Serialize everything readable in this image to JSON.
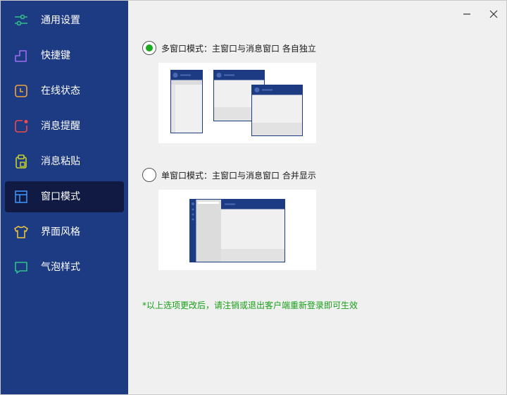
{
  "window": {
    "minimize_icon": "minimize-icon",
    "close_icon": "close-icon"
  },
  "sidebar": {
    "items": [
      {
        "label": "通用设置",
        "icon": "sliders-icon",
        "color": "#2ec08a",
        "active": false
      },
      {
        "label": "快捷键",
        "icon": "step-icon",
        "color": "#9b6cf0",
        "active": false
      },
      {
        "label": "在线状态",
        "icon": "clock-icon",
        "color": "#f2a23a",
        "active": false
      },
      {
        "label": "消息提醒",
        "icon": "notification-icon",
        "color": "#f04a4a",
        "active": false
      },
      {
        "label": "消息粘贴",
        "icon": "clipboard-icon",
        "color": "#c7d12e",
        "active": false
      },
      {
        "label": "窗口模式",
        "icon": "layout-icon",
        "color": "#3d8ff5",
        "active": true
      },
      {
        "label": "界面风格",
        "icon": "shirt-icon",
        "color": "#f2c93a",
        "active": false
      },
      {
        "label": "气泡样式",
        "icon": "chat-bubble-icon",
        "color": "#2ec08a",
        "active": false
      }
    ]
  },
  "options": [
    {
      "label": "多窗口模式：主窗口与消息窗口  各自独立",
      "checked": true
    },
    {
      "label": "单窗口模式：主窗口与消息窗口  合并显示",
      "checked": false
    }
  ],
  "note": "*以上选项更改后，请注销或退出客户端重新登录即可生效",
  "colors": {
    "sidebar_bg": "#1d3b83",
    "active_bg": "#101a42",
    "radio_checked": "#1aab1f",
    "note": "#17a017",
    "preview_header": "#1d3b83"
  }
}
